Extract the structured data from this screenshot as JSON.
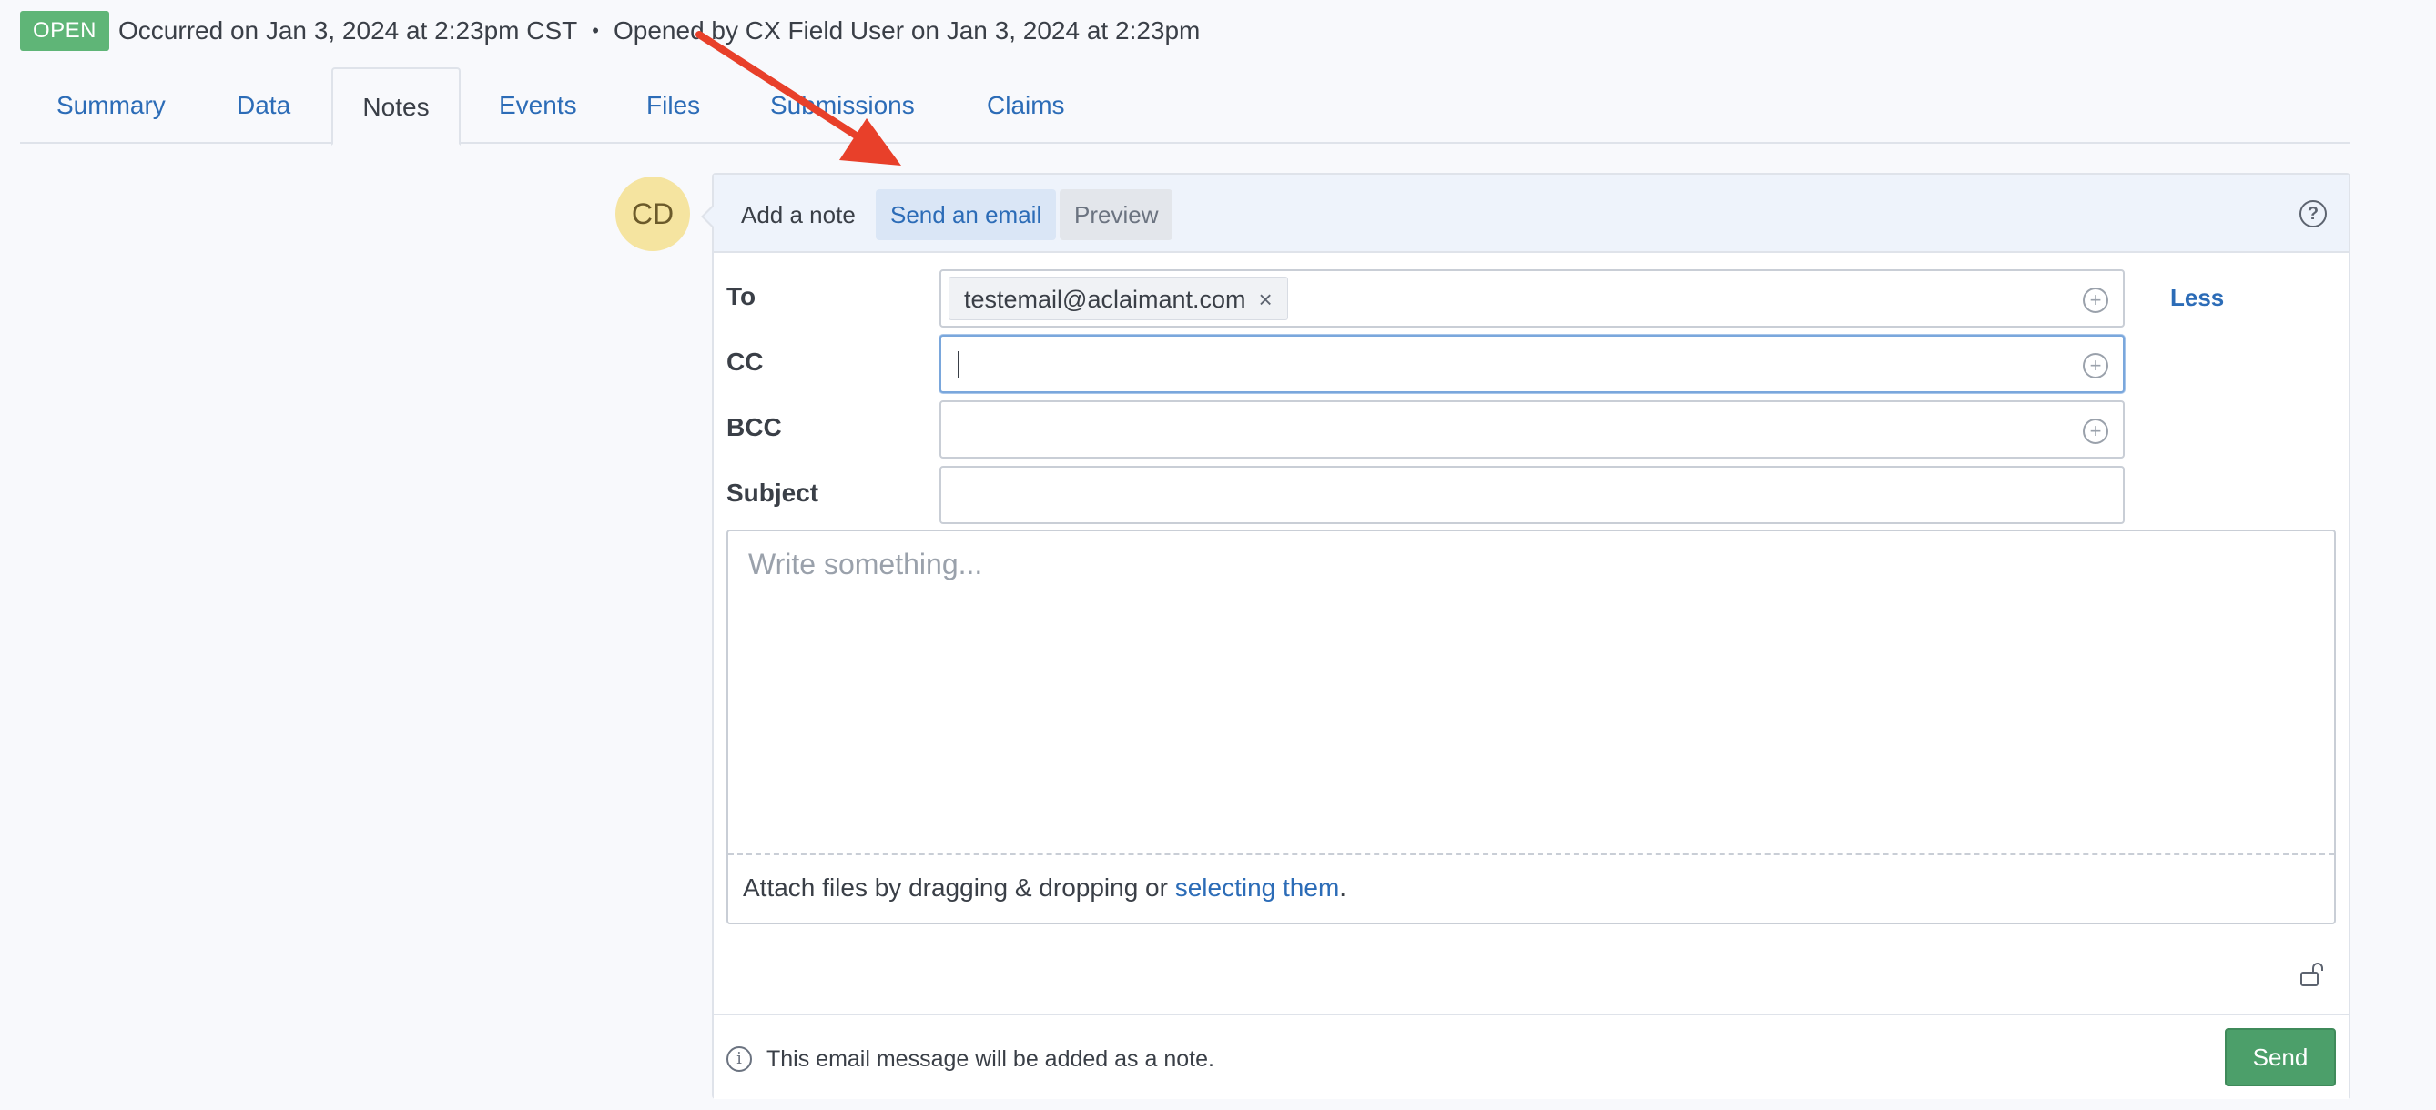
{
  "header": {
    "status_badge": "OPEN",
    "occurred": "Occurred on Jan 3, 2024 at 2:23pm CST",
    "separator": "•",
    "opened": "Opened by CX Field User on Jan 3, 2024 at 2:23pm"
  },
  "tabs": [
    {
      "label": "Summary"
    },
    {
      "label": "Data"
    },
    {
      "label": "Notes"
    },
    {
      "label": "Events"
    },
    {
      "label": "Files"
    },
    {
      "label": "Submissions"
    },
    {
      "label": "Claims"
    }
  ],
  "active_tab": "Notes",
  "avatar": {
    "initials": "CD"
  },
  "composer": {
    "modes": {
      "note": "Add a note",
      "email": "Send an email",
      "preview": "Preview"
    },
    "active_mode": "Send an email",
    "help_glyph": "?",
    "fields": {
      "to_label": "To",
      "to_chip": "testemail@aclaimant.com",
      "to_chip_remove": "×",
      "cc_label": "CC",
      "bcc_label": "BCC",
      "subject_label": "Subject",
      "subject_value": ""
    },
    "less_link": "Less",
    "body_placeholder": "Write something...",
    "attach_prefix": "Attach files by dragging & dropping or ",
    "attach_link": "selecting them",
    "attach_suffix": ".",
    "footer_info_glyph": "i",
    "footer_note": "This email message will be added as a note.",
    "send_label": "Send"
  },
  "colors": {
    "accent": "#2c6cb7",
    "badge": "#5fb577",
    "send": "#4c9f6a",
    "annotation_arrow": "#e8402a"
  },
  "icons": [
    "plus-circle-icon",
    "help-circle-icon",
    "info-circle-icon",
    "unlock-icon",
    "close-icon"
  ]
}
